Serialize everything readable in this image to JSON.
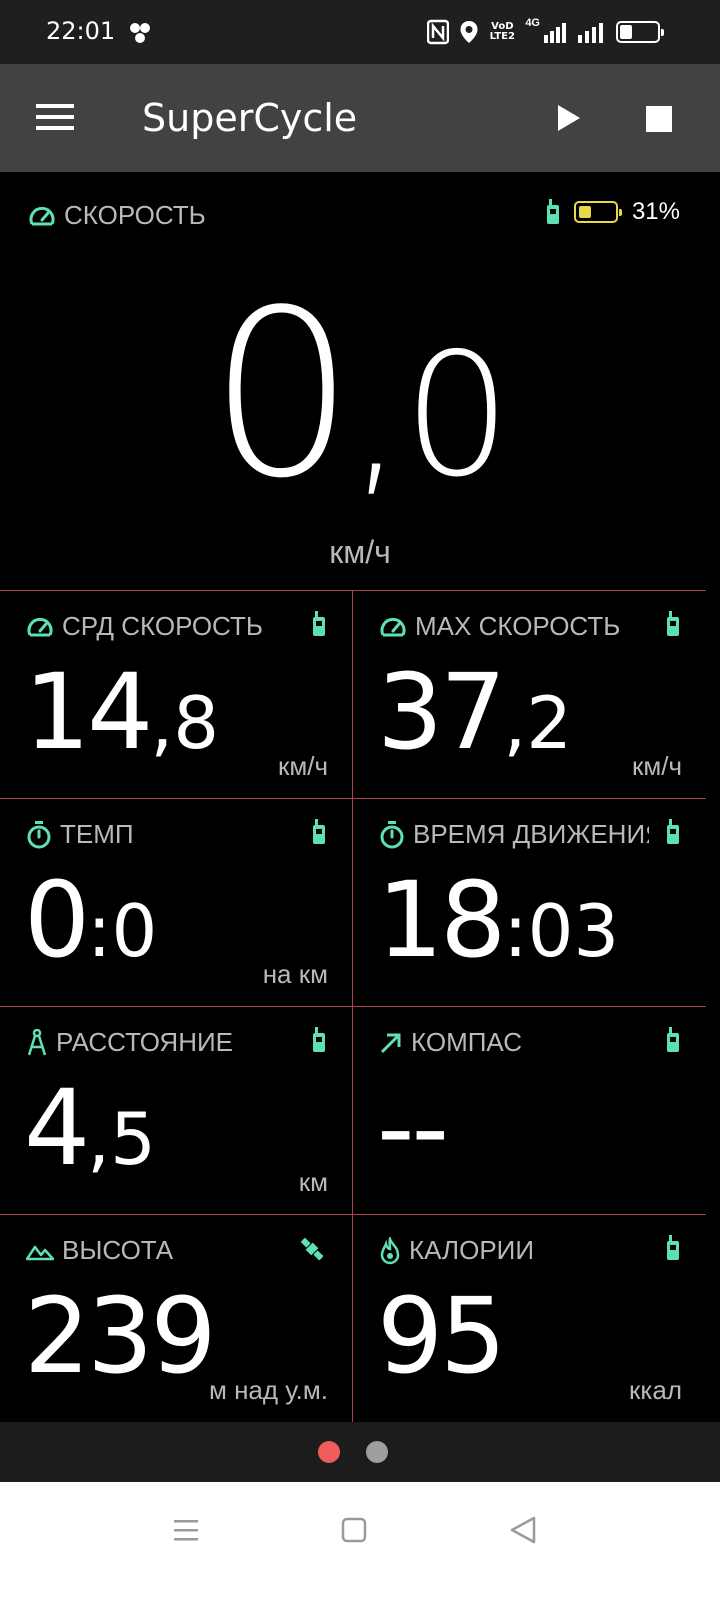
{
  "status_bar": {
    "time": "22:01",
    "network": "4G",
    "volte": "VoD LTE2",
    "battery_level": 0.3
  },
  "app_bar": {
    "title": "SuperCycle"
  },
  "speed": {
    "label": "СКОРОСТЬ",
    "value_int": "0",
    "separator": ",",
    "value_dec": "0",
    "unit": "км/ч",
    "sensor_battery": "31%",
    "sensor_battery_level": 0.31
  },
  "metrics": [
    {
      "label": "СРД СКОРОСТЬ",
      "int": "14",
      "sep": ",",
      "dec": "8",
      "unit": "км/ч",
      "icon": "speedometer-icon",
      "source": "phone"
    },
    {
      "label": "MAX СКОРОСТЬ",
      "int": "37",
      "sep": ",",
      "dec": "2",
      "unit": "км/ч",
      "icon": "speedometer-icon",
      "source": "phone"
    },
    {
      "label": "ТЕМП",
      "int": "0",
      "sep": ":",
      "dec": "0",
      "unit": "на км",
      "icon": "stopwatch-icon",
      "source": "phone"
    },
    {
      "label": "ВРЕМЯ ДВИЖЕНИЯ",
      "int": "18",
      "sep": ":",
      "dec": "03",
      "unit": "",
      "icon": "stopwatch-icon",
      "source": "phone"
    },
    {
      "label": "РАССТОЯНИЕ",
      "int": "4",
      "sep": ",",
      "dec": "5",
      "unit": "км",
      "icon": "compass-drawing-icon",
      "source": "phone"
    },
    {
      "label": "КОМПАС",
      "int": "--",
      "sep": "",
      "dec": "",
      "unit": "",
      "icon": "arrow-up-right-icon",
      "source": "phone"
    },
    {
      "label": "ВЫСОТА",
      "int": "239",
      "sep": "",
      "dec": "",
      "unit": "м над у.м.",
      "icon": "mountain-icon",
      "source": "satellite"
    },
    {
      "label": "КАЛОРИИ",
      "int": "95",
      "sep": "",
      "dec": "",
      "unit": "ккал",
      "icon": "flame-icon",
      "source": "phone"
    }
  ],
  "colors": {
    "accent": "#5fe0b4",
    "grid_line": "#a8444a",
    "battery_warn": "#e8d84a",
    "pager_active": "#f05b5b"
  }
}
